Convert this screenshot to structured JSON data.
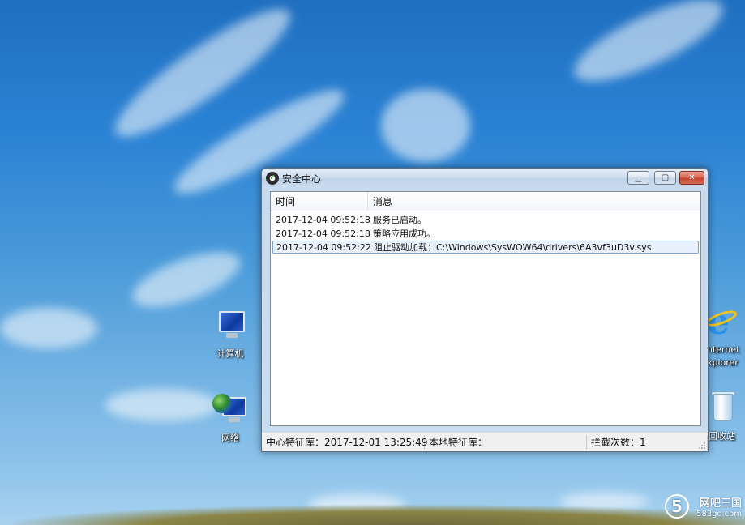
{
  "desktop": {
    "icons": [
      {
        "label": "计算机"
      },
      {
        "label": "网络"
      },
      {
        "label": "nternet xplorer"
      },
      {
        "label": "回收站"
      }
    ],
    "watermark": {
      "logo": "5",
      "name": "网吧三国",
      "url": "583go.com"
    }
  },
  "window": {
    "title": "安全中心",
    "caption_buttons": {
      "minimize": "▁",
      "maximize": "▢",
      "close": "✕"
    },
    "list": {
      "columns": [
        "时间",
        "消息"
      ],
      "rows": [
        {
          "time": "2017-12-04 09:52:18",
          "message": "服务已启动。",
          "selected": false
        },
        {
          "time": "2017-12-04 09:52:18",
          "message": "策略应用成功。",
          "selected": false
        },
        {
          "time": "2017-12-04 09:52:22",
          "message": "阻止驱动加载：C:\\Windows\\SysWOW64\\drivers\\6A3vf3uD3v.sys",
          "selected": true
        }
      ]
    },
    "statusbar": {
      "center_db": "中心特征库：2017-12-01 13:25:49",
      "local_db": "本地特征库：",
      "block_count": "拦截次数：1"
    }
  },
  "colors": {
    "selection_border": "#7da2ce",
    "close_button": "#c3412c"
  },
  "icons": [
    "computer-icon",
    "network-icon",
    "internet-explorer-icon",
    "recycle-bin-icon",
    "security-center-app-icon"
  ]
}
